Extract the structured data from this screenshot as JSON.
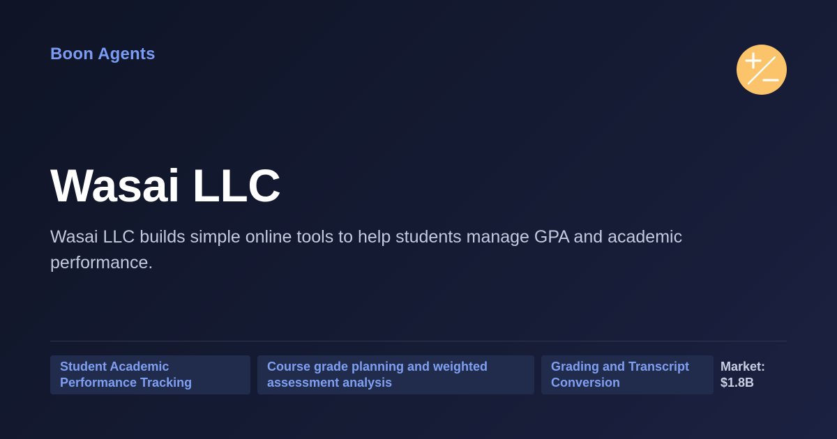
{
  "brand": {
    "name": "Boon Agents"
  },
  "logo": {
    "icon": "plus-minus-icon",
    "color": "#fcc46a"
  },
  "company": {
    "name": "Wasai LLC",
    "description": "Wasai LLC builds simple online tools to help students manage GPA and academic performance."
  },
  "tags": [
    {
      "label": "Student Academic Performance Tracking"
    },
    {
      "label": "Course grade planning and weighted assessment analysis"
    },
    {
      "label": "Grading and Transcript Conversion"
    }
  ],
  "market": {
    "label": "Market:",
    "value": "$1.8B"
  },
  "colors": {
    "background": "#131a2e",
    "accent": "#7b9cf5",
    "tag_background": "#212c4d"
  }
}
